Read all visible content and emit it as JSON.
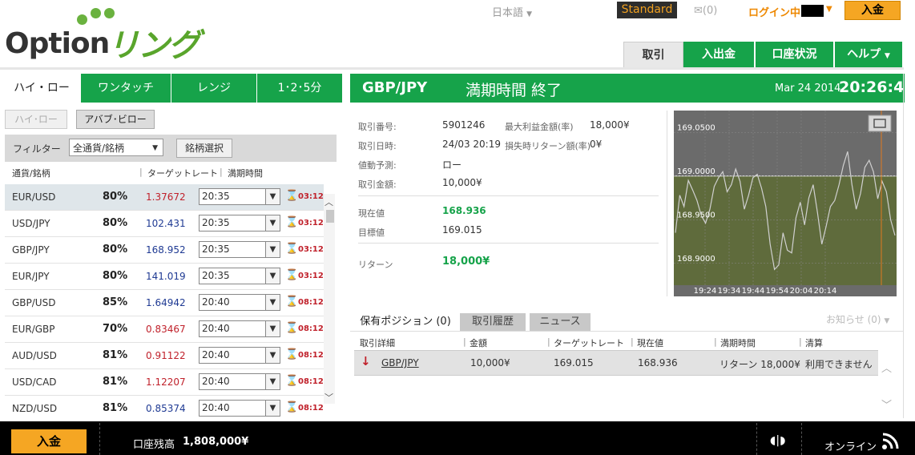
{
  "header": {
    "logo_text": "Option",
    "logo_brand": "リング",
    "language": "日本語",
    "account_type": "Standard",
    "mail_count": "(0)",
    "login_status": "ログイン中",
    "deposit_button": "入金"
  },
  "main_nav": [
    {
      "label": "取引"
    },
    {
      "label": "入出金"
    },
    {
      "label": "口座状況"
    },
    {
      "label": "ヘルプ"
    }
  ],
  "left_tabs": [
    {
      "label": "ハイ・ロー"
    },
    {
      "label": "ワンタッチ"
    },
    {
      "label": "レンジ"
    },
    {
      "label": "1･2･5分"
    }
  ],
  "sub_tabs": [
    {
      "label": "ハイ･ロー"
    },
    {
      "label": "アバブ･ビロー"
    }
  ],
  "filter": {
    "label": "フィルター",
    "selected": "全通貨/銘柄",
    "button": "銘柄選択"
  },
  "list_headers": {
    "symbol": "通貨/銘柄",
    "target_rate": "ターゲットレート",
    "expiry": "満期時間"
  },
  "instruments": [
    {
      "symbol": "EUR/USD",
      "payout": "80%",
      "rate": "1.37672",
      "rate_color": "red",
      "time": "20:35",
      "countdown": "03:12",
      "selected": true
    },
    {
      "symbol": "USD/JPY",
      "payout": "80%",
      "rate": "102.431",
      "rate_color": "blue",
      "time": "20:35",
      "countdown": "03:12",
      "selected": false
    },
    {
      "symbol": "GBP/JPY",
      "payout": "80%",
      "rate": "168.952",
      "rate_color": "blue",
      "time": "20:35",
      "countdown": "03:12",
      "selected": false
    },
    {
      "symbol": "EUR/JPY",
      "payout": "80%",
      "rate": "141.019",
      "rate_color": "blue",
      "time": "20:35",
      "countdown": "03:12",
      "selected": false
    },
    {
      "symbol": "GBP/USD",
      "payout": "85%",
      "rate": "1.64942",
      "rate_color": "blue",
      "time": "20:40",
      "countdown": "08:12",
      "selected": false
    },
    {
      "symbol": "EUR/GBP",
      "payout": "70%",
      "rate": "0.83467",
      "rate_color": "red",
      "time": "20:40",
      "countdown": "08:12",
      "selected": false
    },
    {
      "symbol": "AUD/USD",
      "payout": "81%",
      "rate": "0.91122",
      "rate_color": "red",
      "time": "20:40",
      "countdown": "08:12",
      "selected": false
    },
    {
      "symbol": "USD/CAD",
      "payout": "81%",
      "rate": "1.12207",
      "rate_color": "red",
      "time": "20:40",
      "countdown": "08:12",
      "selected": false
    },
    {
      "symbol": "NZD/USD",
      "payout": "81%",
      "rate": "0.85374",
      "rate_color": "blue",
      "time": "20:40",
      "countdown": "08:12",
      "selected": false
    }
  ],
  "trade_panel": {
    "symbol": "GBP/JPY",
    "status": "満期時間 終了",
    "date": "Mar 24 2014",
    "time": "20:26:48",
    "trade_id_label": "取引番号:",
    "trade_id": "5901246",
    "max_profit_label": "最大利益金額(率)",
    "max_profit": "18,000¥",
    "trade_datetime_label": "取引日時:",
    "trade_datetime": "24/03 20:19",
    "loss_return_label": "損失時リターン額(率)",
    "loss_return": "0¥",
    "forecast_label": "値動予測:",
    "forecast": "ロー",
    "amount_label": "取引金額:",
    "amount": "10,000¥",
    "current_label": "現在値",
    "current": "168.936",
    "target_label": "目標値",
    "target": "169.015",
    "return_label": "リターン",
    "return": "18,000¥"
  },
  "chart_data": {
    "type": "line",
    "x_ticks": [
      "19:24",
      "19:34",
      "19:44",
      "19:54",
      "20:04",
      "20:14"
    ],
    "y_ticks": [
      "169.0500",
      "169.0000",
      "168.9500",
      "168.9000"
    ],
    "ylim": [
      168.875,
      169.075
    ],
    "target_line": 169.0,
    "series": [
      {
        "values": [
          168.935,
          168.978,
          168.965,
          168.995,
          168.984,
          168.972,
          168.955,
          168.946,
          168.962,
          168.988,
          168.998,
          169.005,
          168.982,
          168.99,
          169.008,
          168.994,
          168.962,
          168.978,
          168.998,
          169.002,
          168.986,
          168.965,
          168.922,
          168.893,
          168.898,
          168.935,
          168.915,
          168.912,
          168.952,
          168.97,
          168.944,
          168.975,
          168.99,
          168.958,
          168.922,
          168.942,
          168.965,
          168.972,
          168.99,
          169.012,
          169.028,
          168.99,
          168.962,
          168.98,
          169.01,
          169.018,
          169.005,
          168.974,
          168.994,
          168.982,
          168.95,
          168.932
        ]
      }
    ]
  },
  "positions": {
    "tabs": [
      {
        "label": "保有ポジション (0)"
      },
      {
        "label": "取引履歴"
      },
      {
        "label": "ニュース"
      }
    ],
    "notice": "お知らせ (0)",
    "headers": {
      "detail": "取引詳細",
      "amount": "金額",
      "target": "ターゲットレート",
      "current": "現在値",
      "expiry": "満期時間",
      "settle": "清算"
    },
    "row": {
      "symbol": "GBP/JPY",
      "amount": "10,000¥",
      "target": "169.015",
      "current": "168.936",
      "expiry": "リターン 18,000¥",
      "settle": "利用できません"
    }
  },
  "footer": {
    "deposit_button": "入金",
    "balance_label": "口座残高",
    "balance": "1,808,000¥",
    "online_status": "オンライン"
  }
}
